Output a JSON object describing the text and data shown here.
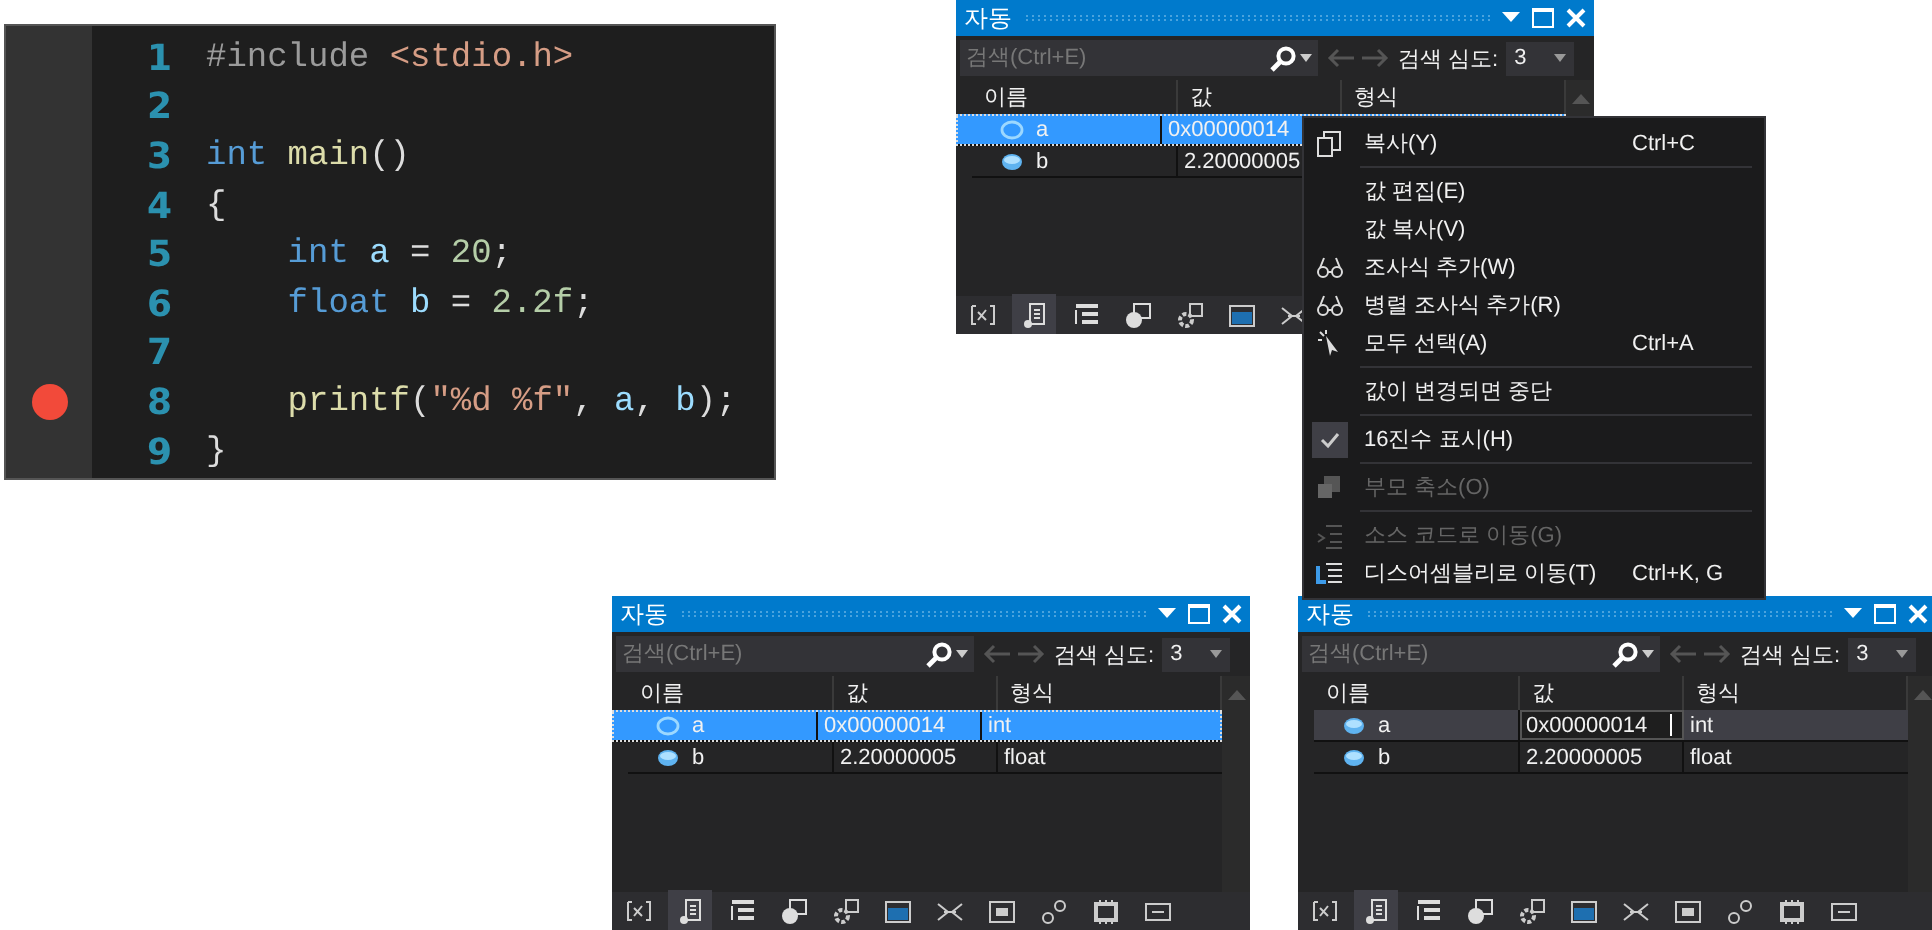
{
  "code_editor": {
    "lines": [
      {
        "number": "1",
        "breakpoint": false,
        "indent": false,
        "tokens": [
          {
            "text": "#include",
            "kind": "preprocessor"
          },
          {
            "text": "<stdio.h>",
            "kind": "string",
            "space": true
          }
        ]
      },
      {
        "number": "2",
        "breakpoint": false
      },
      {
        "number": "3",
        "breakpoint": false,
        "indent": false,
        "tokens": [
          {
            "text": "int",
            "kind": "keyword"
          },
          {
            "text": "main",
            "kind": "function",
            "space": true
          },
          {
            "text": "()",
            "kind": "plain"
          }
        ]
      },
      {
        "number": "4",
        "breakpoint": false,
        "indent": false,
        "tokens": [
          {
            "text": "{",
            "kind": "plain"
          }
        ]
      },
      {
        "number": "5",
        "breakpoint": false,
        "indent": true,
        "tokens": [
          {
            "text": "int",
            "kind": "keyword"
          },
          {
            "text": "a",
            "kind": "variable",
            "space": true
          },
          {
            "text": "=",
            "kind": "plain",
            "space": true
          },
          {
            "text": "20",
            "kind": "number",
            "space": true
          },
          {
            "text": ";",
            "kind": "plain"
          }
        ]
      },
      {
        "number": "6",
        "breakpoint": false,
        "indent": true,
        "tokens": [
          {
            "text": "float",
            "kind": "keyword"
          },
          {
            "text": "b",
            "kind": "variable",
            "space": true
          },
          {
            "text": "=",
            "kind": "plain",
            "space": true
          },
          {
            "text": "2.2f",
            "kind": "number",
            "space": true
          },
          {
            "text": ";",
            "kind": "plain"
          }
        ]
      },
      {
        "number": "7",
        "breakpoint": false
      },
      {
        "number": "8",
        "breakpoint": true,
        "indent": true,
        "tokens": [
          {
            "text": "printf",
            "kind": "function"
          },
          {
            "text": "(",
            "kind": "plain"
          },
          {
            "text": "\"%d %f\"",
            "kind": "string"
          },
          {
            "text": ",",
            "kind": "plain"
          },
          {
            "text": "a",
            "kind": "variable",
            "space": true
          },
          {
            "text": ",",
            "kind": "plain"
          },
          {
            "text": "b",
            "kind": "variable",
            "space": true
          },
          {
            "text": ");",
            "kind": "plain"
          }
        ]
      },
      {
        "number": "9",
        "breakpoint": false,
        "indent": false,
        "tokens": [
          {
            "text": "}",
            "kind": "plain"
          }
        ]
      }
    ]
  },
  "panels": [
    {
      "title": "자동",
      "search": {
        "placeholder": "검색(Ctrl+E)"
      },
      "depth_label": "검색 심도:",
      "depth_value": "3",
      "columns": [
        "이름",
        "값",
        "형식"
      ],
      "rows": [
        {
          "name": "a",
          "value": "0x00000014",
          "selected": true,
          "editing": false
        },
        {
          "name": "b",
          "value": "2.20000005",
          "selected": false,
          "editing": false
        }
      ],
      "context_menu": [
        {
          "kind": "item",
          "label": "복사(Y)",
          "shortcut": "Ctrl+C",
          "disabled": false,
          "checked": false
        },
        {
          "kind": "separator"
        },
        {
          "kind": "item",
          "label": "값 편집(E)",
          "disabled": false,
          "checked": false
        },
        {
          "kind": "item",
          "label": "값 복사(V)",
          "disabled": false,
          "checked": false
        },
        {
          "kind": "item",
          "label": "조사식 추가(W)",
          "disabled": false,
          "checked": false
        },
        {
          "kind": "item",
          "label": "병렬 조사식 추가(R)",
          "disabled": false,
          "checked": false
        },
        {
          "kind": "item",
          "label": "모두 선택(A)",
          "shortcut": "Ctrl+A",
          "disabled": false,
          "checked": false
        },
        {
          "kind": "separator"
        },
        {
          "kind": "item",
          "label": "값이 변경되면 중단",
          "disabled": false,
          "checked": false
        },
        {
          "kind": "separator"
        },
        {
          "kind": "item",
          "label": "16진수 표시(H)",
          "disabled": false,
          "checked": true
        },
        {
          "kind": "separator"
        },
        {
          "kind": "item",
          "label": "부모 축소(O)",
          "disabled": true,
          "checked": false
        },
        {
          "kind": "separator"
        },
        {
          "kind": "item",
          "label": "소스 코드로 이동(G)",
          "disabled": true,
          "checked": false
        },
        {
          "kind": "item",
          "label": "디스어셈블리로 이동(T)",
          "shortcut": "Ctrl+K, G",
          "disabled": false,
          "checked": false
        }
      ]
    },
    {
      "title": "자동",
      "search": {
        "placeholder": "검색(Ctrl+E)"
      },
      "depth_label": "검색 심도:",
      "depth_value": "3",
      "columns": [
        "이름",
        "값",
        "형식"
      ],
      "rows": [
        {
          "name": "a",
          "value": "0x00000014",
          "type": "int",
          "selected": true,
          "editing": false
        },
        {
          "name": "b",
          "value": "2.20000005",
          "type": "float",
          "selected": false,
          "editing": false
        }
      ]
    },
    {
      "title": "자동",
      "search": {
        "placeholder": "검색(Ctrl+E)"
      },
      "depth_label": "검색 심도:",
      "depth_value": "3",
      "columns": [
        "이름",
        "값",
        "형식"
      ],
      "rows": [
        {
          "name": "a",
          "value": "0x00000014",
          "type": "int",
          "selected": true,
          "editing": true
        },
        {
          "name": "b",
          "value": "2.20000005",
          "type": "float",
          "selected": false,
          "editing": false
        }
      ]
    }
  ]
}
